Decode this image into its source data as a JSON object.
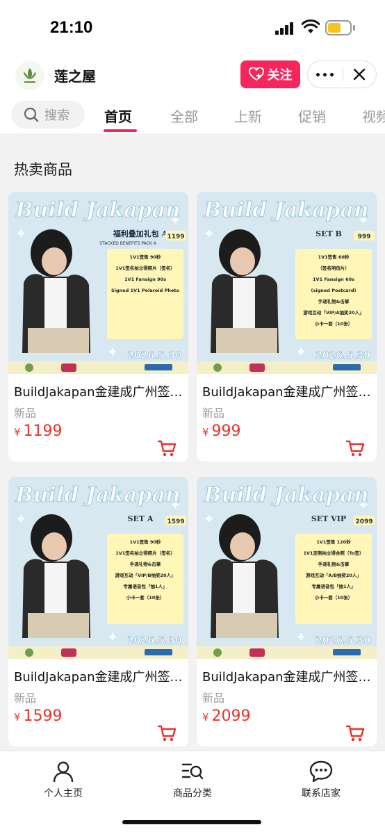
{
  "status_bar": {
    "time": "21:10"
  },
  "shop": {
    "name": "莲之屋",
    "follow_label": "关注"
  },
  "nav": {
    "search_placeholder": "搜索",
    "tabs": [
      {
        "label": "首页",
        "active": true
      },
      {
        "label": "全部",
        "active": false
      },
      {
        "label": "上新",
        "active": false
      },
      {
        "label": "促销",
        "active": false
      },
      {
        "label": "视频",
        "active": false
      }
    ]
  },
  "section": {
    "title": "热卖商品"
  },
  "products": [
    {
      "title": "BuildJakapan金建成广州签售会",
      "tag": "新品",
      "currency": "¥",
      "price": "1199",
      "poster": {
        "heading": "Build Jakapan",
        "set_label": "福利叠加礼包 A",
        "set_sub": "STACKED BENEFITS PACK A",
        "set_price": "1199",
        "lines": [
          "1V1签售 90秒",
          "1V1签名拍立得照片（签名）",
          "1V1 Fansign 90s",
          "Signed 1V1 Polaroid Photo"
        ],
        "date": "2026.5.30"
      }
    },
    {
      "title": "BuildJakapan金建成广州签售会",
      "tag": "新品",
      "currency": "¥",
      "price": "999",
      "poster": {
        "heading": "Build Jakapan",
        "set_label": "SET B",
        "set_sub": "",
        "set_price": "999",
        "lines": [
          "1V1签售 60秒",
          "（签名明信片）",
          "1V1 Fansign 60s",
          "(signed Postcard)",
          "手递礼物&击掌",
          "游戏互动「VIP/A抽奖20人」",
          "小卡一套（10张）"
        ],
        "date": "2026.5.30"
      }
    },
    {
      "title": "BuildJakapan金建成广州签售会",
      "tag": "新品",
      "currency": "¥",
      "price": "1599",
      "poster": {
        "heading": "Build Jakapan",
        "set_label": "SET A",
        "set_sub": "",
        "set_price": "1599",
        "lines": [
          "1V1签售 90秒",
          "1V1签名拍立得照片（签名）",
          "手递礼物&击掌",
          "游戏互动「VIP/B抽奖20人」",
          "专属语音包「抽1人」",
          "小卡一套（10张）"
        ],
        "date": "2026.5.30"
      }
    },
    {
      "title": "BuildJakapan金建成广州签售会",
      "tag": "新品",
      "currency": "¥",
      "price": "2099",
      "poster": {
        "heading": "Build Jakapan",
        "set_label": "SET VIP",
        "set_sub": "",
        "set_price": "2099",
        "lines": [
          "1V1签售 120秒",
          "1V1定制拍立得合照（To签）",
          "手递礼物&击掌",
          "游戏互动「A/B抽奖20人」",
          "专属语音包「抽1人」",
          "小卡一套（10张）"
        ],
        "date": "2026.5.30"
      }
    }
  ],
  "bottom_nav": {
    "items": [
      {
        "label": "个人主页"
      },
      {
        "label": "商品分类"
      },
      {
        "label": "联系店家"
      }
    ]
  },
  "colors": {
    "accent": "#f5265b",
    "price": "#e8322a",
    "poster_bg": "#cfe3ee",
    "poster_note": "#fff6b8",
    "poster_footer": "#f4efc6"
  }
}
